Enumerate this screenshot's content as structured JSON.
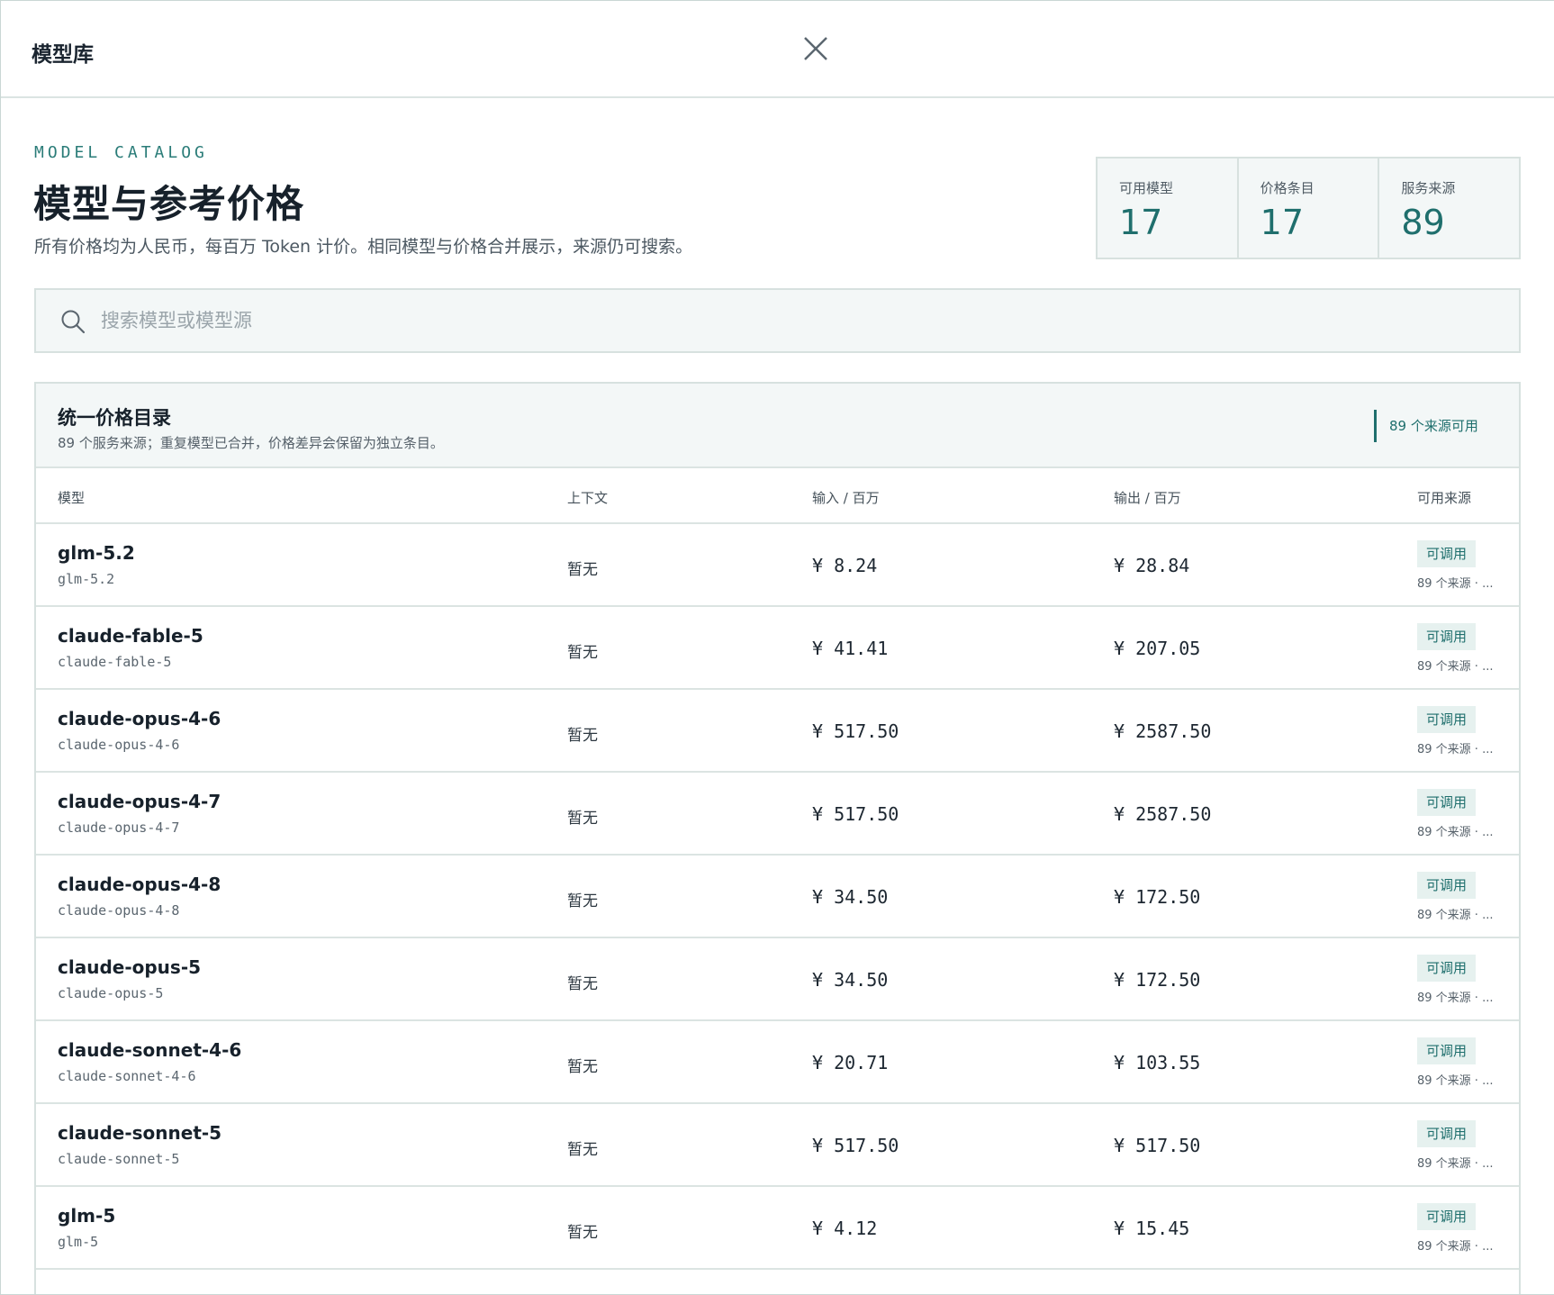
{
  "dialog": {
    "title": "模型库"
  },
  "intro": {
    "eyebrow": "MODEL CATALOG",
    "title": "模型与参考价格",
    "description": "所有价格均为人民币，每百万 Token 计价。相同模型与价格合并展示，来源仍可搜索。"
  },
  "stats": [
    {
      "label": "可用模型",
      "value": "17"
    },
    {
      "label": "价格条目",
      "value": "17"
    },
    {
      "label": "服务来源",
      "value": "89"
    }
  ],
  "search": {
    "placeholder": "搜索模型或模型源",
    "value": ""
  },
  "panel": {
    "title": "统一价格目录",
    "subtitle": "89 个服务来源；重复模型已合并，价格差异会保留为独立条目。",
    "source_badge": "89 个来源可用"
  },
  "columns": {
    "model": "模型",
    "context": "上下文",
    "input": "输入 / 百万",
    "output": "输出 / 百万",
    "sources": "可用来源"
  },
  "rows": [
    {
      "name": "glm-5.2",
      "id": "glm-5.2",
      "context": "暂无",
      "input": "¥ 8.24",
      "output": "¥ 28.84",
      "status": "可调用",
      "sources": "89 个来源 · ..."
    },
    {
      "name": "claude-fable-5",
      "id": "claude-fable-5",
      "context": "暂无",
      "input": "¥ 41.41",
      "output": "¥ 207.05",
      "status": "可调用",
      "sources": "89 个来源 · ..."
    },
    {
      "name": "claude-opus-4-6",
      "id": "claude-opus-4-6",
      "context": "暂无",
      "input": "¥ 517.50",
      "output": "¥ 2587.50",
      "status": "可调用",
      "sources": "89 个来源 · ..."
    },
    {
      "name": "claude-opus-4-7",
      "id": "claude-opus-4-7",
      "context": "暂无",
      "input": "¥ 517.50",
      "output": "¥ 2587.50",
      "status": "可调用",
      "sources": "89 个来源 · ..."
    },
    {
      "name": "claude-opus-4-8",
      "id": "claude-opus-4-8",
      "context": "暂无",
      "input": "¥ 34.50",
      "output": "¥ 172.50",
      "status": "可调用",
      "sources": "89 个来源 · ..."
    },
    {
      "name": "claude-opus-5",
      "id": "claude-opus-5",
      "context": "暂无",
      "input": "¥ 34.50",
      "output": "¥ 172.50",
      "status": "可调用",
      "sources": "89 个来源 · ..."
    },
    {
      "name": "claude-sonnet-4-6",
      "id": "claude-sonnet-4-6",
      "context": "暂无",
      "input": "¥ 20.71",
      "output": "¥ 103.55",
      "status": "可调用",
      "sources": "89 个来源 · ..."
    },
    {
      "name": "claude-sonnet-5",
      "id": "claude-sonnet-5",
      "context": "暂无",
      "input": "¥ 517.50",
      "output": "¥ 517.50",
      "status": "可调用",
      "sources": "89 个来源 · ..."
    },
    {
      "name": "glm-5",
      "id": "glm-5",
      "context": "暂无",
      "input": "¥ 4.12",
      "output": "¥ 15.45",
      "status": "可调用",
      "sources": "89 个来源 · ..."
    }
  ],
  "colors": {
    "accent": "#1f6f6d",
    "panel_bg": "#f3f7f7",
    "border": "#d7e1df"
  }
}
